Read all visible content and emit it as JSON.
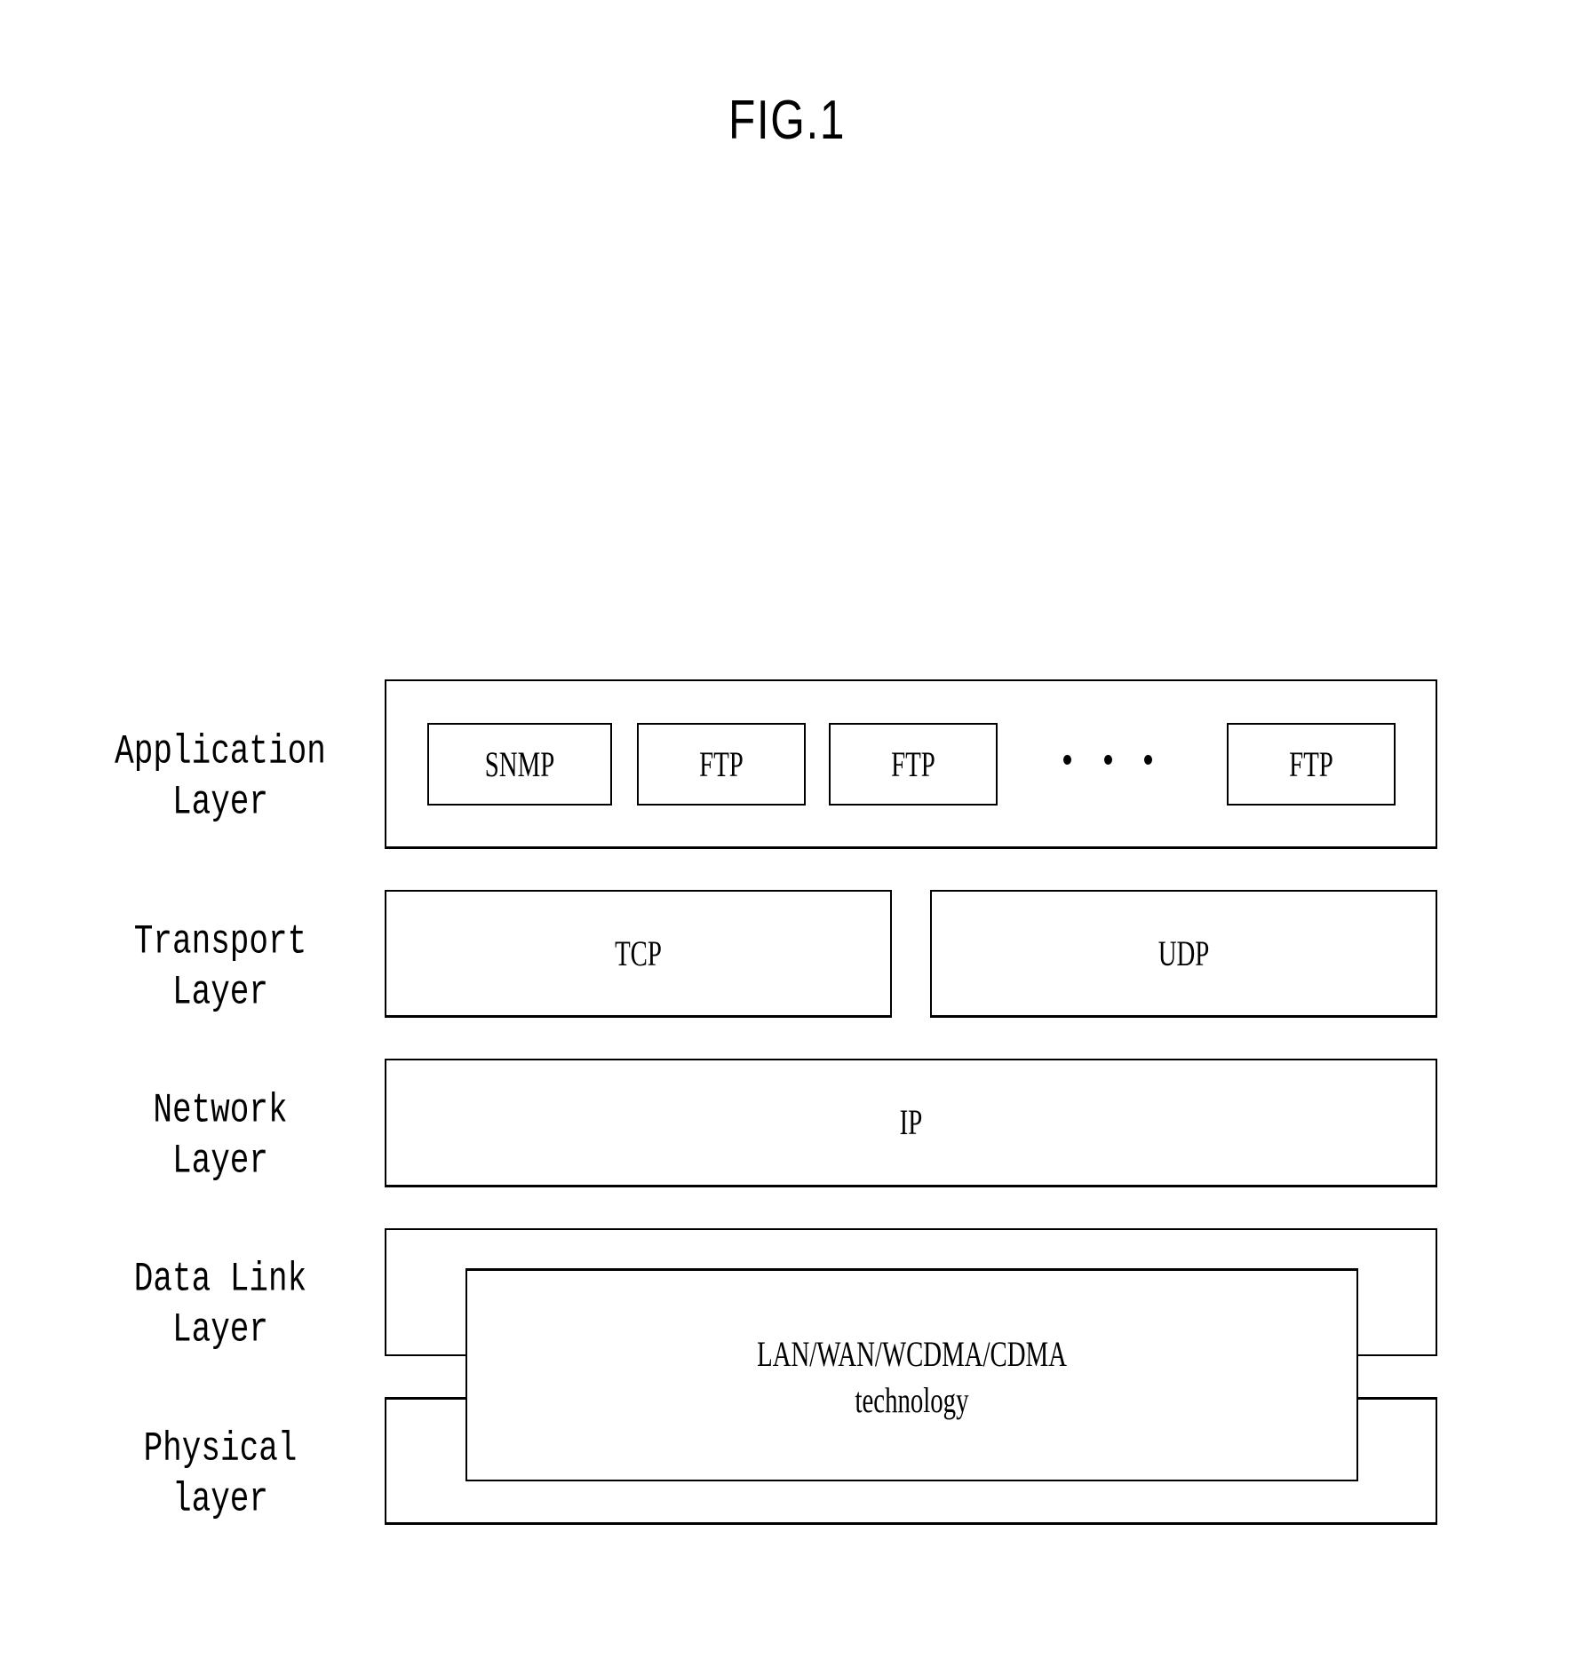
{
  "figure": {
    "title": "FIG.1"
  },
  "layers": [
    {
      "id": "application",
      "label_line1": "Application",
      "label_line2": "Layer"
    },
    {
      "id": "transport",
      "label_line1": "Transport",
      "label_line2": "Layer"
    },
    {
      "id": "network",
      "label_line1": "Network",
      "label_line2": "Layer"
    },
    {
      "id": "datalink",
      "label_line1": "Data Link",
      "label_line2": "Layer"
    },
    {
      "id": "physical",
      "label_line1": "Physical",
      "label_line2": "layer"
    }
  ],
  "application_protocols": [
    "SNMP",
    "FTP",
    "FTP",
    "FTP"
  ],
  "ellipsis": "• • •",
  "transport_protocols": [
    "TCP",
    "UDP"
  ],
  "network_protocol": "IP",
  "link_physical": {
    "line1": "LAN/WAN/WCDMA/CDMA",
    "line2": "technology"
  }
}
